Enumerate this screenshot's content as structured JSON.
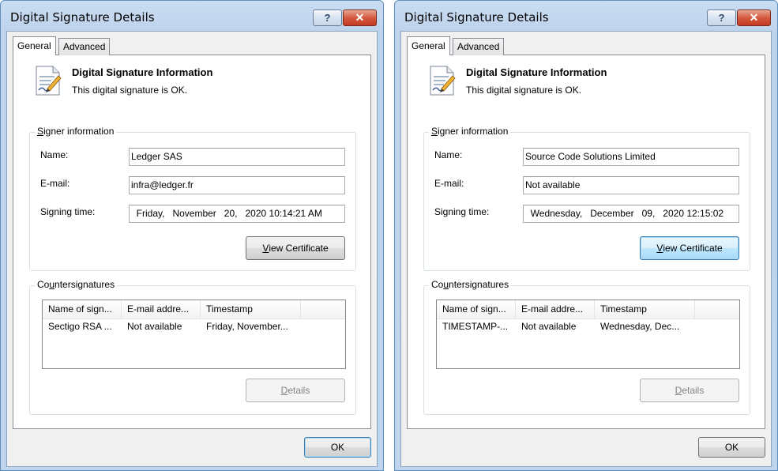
{
  "dialogs": [
    {
      "title": "Digital Signature Details",
      "help_glyph": "?",
      "close_glyph": "✕",
      "tabs": [
        "General",
        "Advanced"
      ],
      "info_title": "Digital Signature Information",
      "info_status": "This digital signature is OK.",
      "signer_legend_pre": "S",
      "signer_legend_rest": "igner information",
      "name_label": "Name:",
      "name_value": "Ledger SAS",
      "email_label": "E-mail:",
      "email_value": "infra@ledger.fr",
      "signing_time_label": "Signing time:",
      "signing_time_value": "  Friday,   November   20,   2020 10:14:21 AM",
      "view_cert_pre": "V",
      "view_cert_rest": "iew Certificate",
      "counter_legend_pre": "Co",
      "counter_legend_u": "u",
      "counter_legend_rest": "ntersignatures",
      "columns": [
        "Name of sign...",
        "E-mail addre...",
        "Timestamp"
      ],
      "rows": [
        [
          "Sectigo RSA ...",
          "Not available",
          "Friday, November..."
        ]
      ],
      "details_pre": "D",
      "details_rest": "etails",
      "ok_label": "OK"
    },
    {
      "title": "Digital Signature Details",
      "help_glyph": "?",
      "close_glyph": "✕",
      "tabs": [
        "General",
        "Advanced"
      ],
      "info_title": "Digital Signature Information",
      "info_status": "This digital signature is OK.",
      "signer_legend_pre": "S",
      "signer_legend_rest": "igner information",
      "name_label": "Name:",
      "name_value": "Source Code Solutions Limited",
      "email_label": "E-mail:",
      "email_value": "Not available",
      "signing_time_label": "Signing time:",
      "signing_time_value": "  Wednesday,   December   09,   2020 12:15:02",
      "view_cert_pre": "V",
      "view_cert_rest": "iew Certificate",
      "counter_legend_pre": "Co",
      "counter_legend_u": "u",
      "counter_legend_rest": "ntersignatures",
      "columns": [
        "Name of sign...",
        "E-mail addre...",
        "Timestamp"
      ],
      "rows": [
        [
          "TIMESTAMP-...",
          "Not available",
          "Wednesday, Dec..."
        ]
      ],
      "details_pre": "D",
      "details_rest": "etails",
      "ok_label": "OK"
    }
  ]
}
